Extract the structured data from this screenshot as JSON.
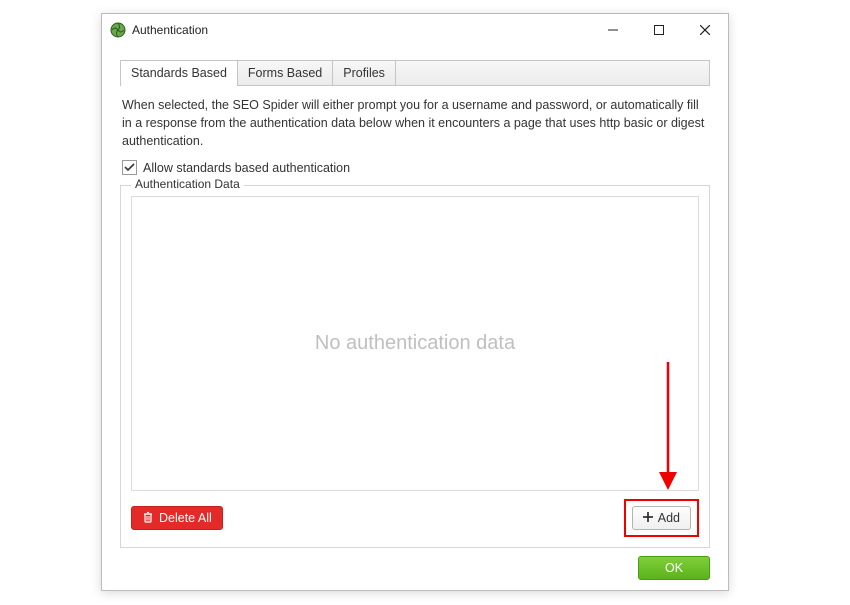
{
  "window": {
    "title": "Authentication"
  },
  "tabs": [
    {
      "label": "Standards Based"
    },
    {
      "label": "Forms Based"
    },
    {
      "label": "Profiles"
    }
  ],
  "description": "When selected, the SEO Spider will either prompt you for a username and password, or automatically fill in a response from the authentication data below when it encounters a page that uses http basic or digest authentication.",
  "checkbox": {
    "label": "Allow standards based authentication",
    "checked": true
  },
  "group": {
    "title": "Authentication Data",
    "placeholder": "No authentication data"
  },
  "buttons": {
    "delete_all": "Delete All",
    "add": "Add",
    "ok": "OK"
  },
  "annotation": {
    "arrow_color": "#f10000"
  }
}
